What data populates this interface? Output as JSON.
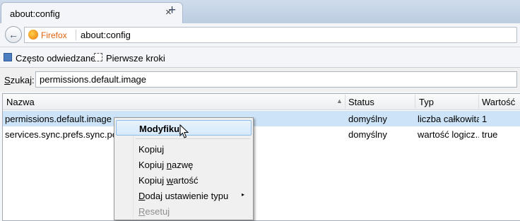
{
  "tab": {
    "title": "about:config",
    "close": "×",
    "new_tab": "+"
  },
  "nav": {
    "back": "←",
    "identity": "Firefox",
    "url": "about:config"
  },
  "bookmarks": [
    "Często odwiedzane",
    "Pierwsze kroki"
  ],
  "search": {
    "label_accesskey": "S",
    "label_rest": "zukaj:",
    "value": "permissions.default.image"
  },
  "columns": [
    "Nazwa",
    "Status",
    "Typ",
    "Wartość"
  ],
  "rows": [
    {
      "name": "permissions.default.image",
      "status": "domyślny",
      "type": "liczba całkowita",
      "value": "1"
    },
    {
      "name": "services.sync.prefs.sync.perm",
      "status": "domyślny",
      "type": "wartość logicz...",
      "value": "true"
    }
  ],
  "context_menu": {
    "modify": {
      "text": "Modyfikuj"
    },
    "copy": {
      "text": "Kopiuj"
    },
    "copy_name": {
      "pre": "Kopiuj ",
      "acc": "n",
      "post": "azwę"
    },
    "copy_value": {
      "pre": "Kopiuj ",
      "acc": "w",
      "post": "artość"
    },
    "add_setting": {
      "acc": "D",
      "post": "odaj ustawienie typu",
      "arrow": "▸"
    },
    "reset": {
      "acc": "R",
      "post": "esetuj"
    }
  },
  "colors": {
    "accent": "#e0620d",
    "selection": "#cde4f8",
    "menu_highlight": "#d6e9fb"
  }
}
